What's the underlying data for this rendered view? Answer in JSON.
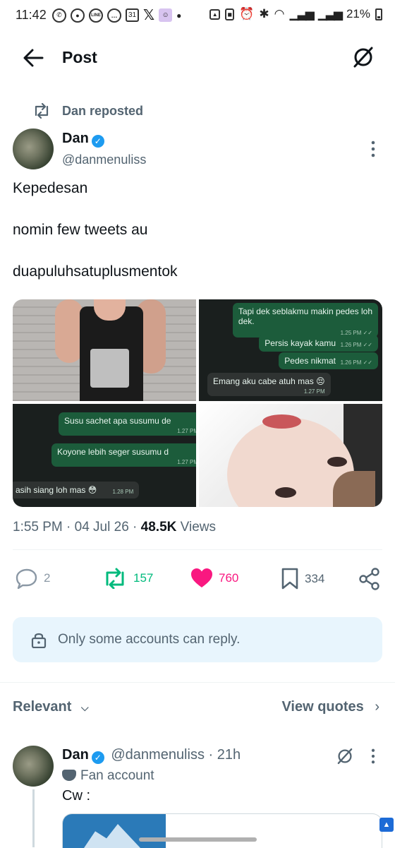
{
  "status_bar": {
    "time": "11:42",
    "battery": "21%"
  },
  "header": {
    "title": "Post"
  },
  "repost": {
    "label": "Dan reposted"
  },
  "post": {
    "name": "Dan",
    "handle": "@danmenuliss",
    "lines": [
      "Kepedesan",
      "nomin few tweets au",
      "duapuluhsatuplusmentok"
    ],
    "chat1": [
      {
        "text": "Tapi dek seblakmu makin pedes loh",
        "text2": "dek.",
        "time": "1.25 PM ✓✓"
      },
      {
        "text": "Persis kayak kamu",
        "time": "1.26 PM ✓✓"
      },
      {
        "text": "Pedes nikmat",
        "time": "1.26 PM ✓✓"
      },
      {
        "text": "Emang aku cabe atuh mas 😔",
        "time": "1.27 PM"
      }
    ],
    "chat2": [
      {
        "text": "Susu sachet apa susumu de",
        "time": "1.27 PM"
      },
      {
        "text": "Koyone lebih seger susumu d",
        "time": "1.27 PM"
      },
      {
        "text": "asih siang loh mas 😳",
        "time": "1.28 PM"
      }
    ],
    "timestamp": "1:55 PM · 04 Jul 26 · ",
    "views_count": "48.5K",
    "views_label": " Views",
    "replies": "2",
    "reposts": "157",
    "likes": "760",
    "bookmarks": "334"
  },
  "notice": {
    "text": "Only some accounts can reply."
  },
  "filters": {
    "relevant": "Relevant",
    "view_quotes": "View quotes"
  },
  "reply": {
    "name": "Dan",
    "handle_time": "@danmenuliss · 21h",
    "bio": "Fan account",
    "text": "Cw :"
  },
  "colors": {
    "accent": "#1d9bf0",
    "repost": "#00ba7c",
    "like": "#f91880",
    "muted": "#536471"
  }
}
